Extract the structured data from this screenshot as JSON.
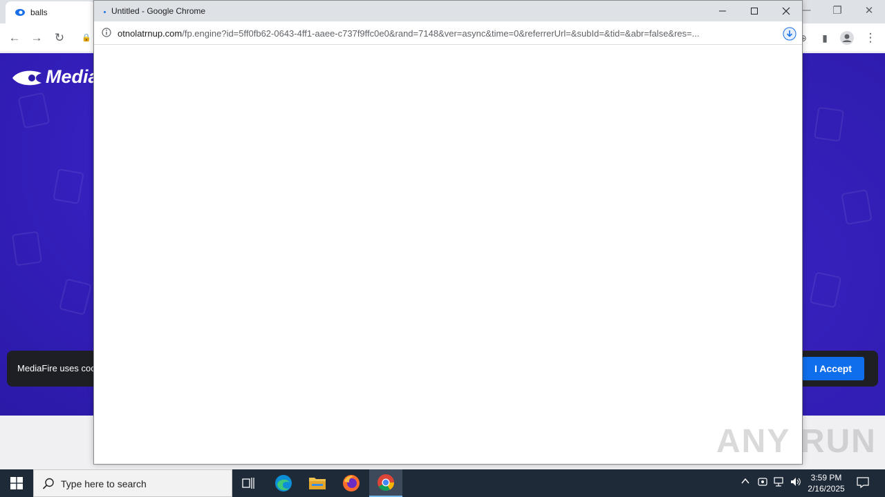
{
  "background_browser": {
    "tab_title": "balls",
    "brand_text": "Media",
    "cookie_text": "MediaFire uses coo",
    "accept_label": "I Accept"
  },
  "popup": {
    "title": "Untitled - Google Chrome",
    "url_host": "otnolatrnup.com",
    "url_path": "/fp.engine?id=5ff0fb62-0643-4ff1-aaee-c737f9ffc0e0&rand=7148&ver=async&time=0&referrerUrl=&subId=&tid=&abr=false&res=..."
  },
  "taskbar": {
    "search_placeholder": "Type here to search",
    "clock_time": "3:59 PM",
    "clock_date": "2/16/2025"
  },
  "watermark": "ANY RUN",
  "colors": {
    "mediafire_bg": "#2b1aa8",
    "accept_button": "#0f6eeb",
    "taskbar": "#1f2a38"
  }
}
